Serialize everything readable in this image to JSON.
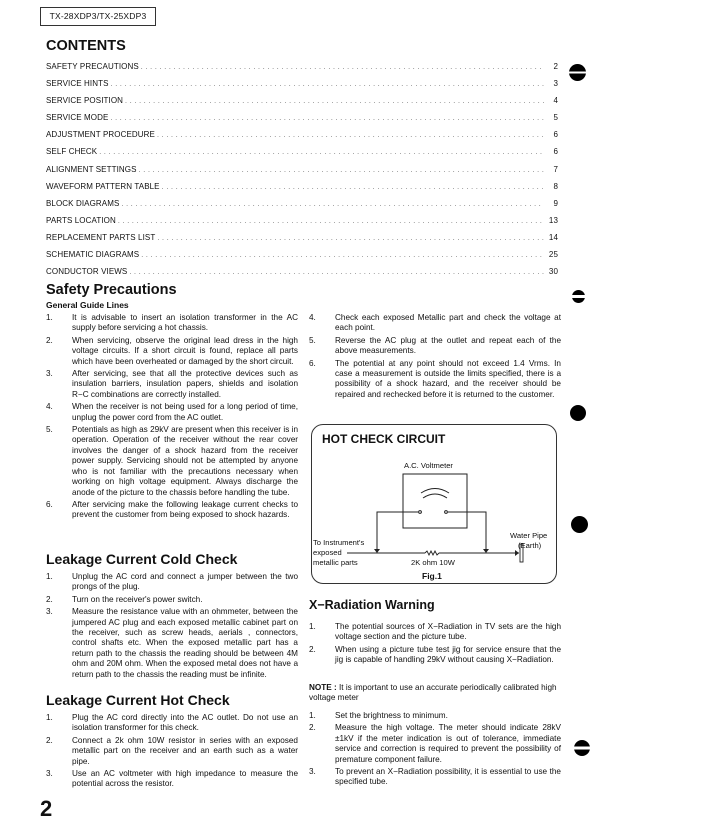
{
  "header": {
    "model": "TX-28XDP3/TX-25XDP3"
  },
  "contents": {
    "title": "CONTENTS",
    "items": [
      {
        "label": "SAFETY PRECAUTIONS",
        "page": "2"
      },
      {
        "label": "SERVICE HINTS",
        "page": "3"
      },
      {
        "label": "SERVICE POSITION",
        "page": "4"
      },
      {
        "label": "SERVICE MODE",
        "page": "5"
      },
      {
        "label": "ADJUSTMENT PROCEDURE",
        "page": "6"
      },
      {
        "label": "SELF CHECK",
        "page": "6"
      },
      {
        "label": "ALIGNMENT SETTINGS",
        "page": "7"
      },
      {
        "label": "WAVEFORM PATTERN TABLE",
        "page": "8"
      },
      {
        "label": "BLOCK DIAGRAMS",
        "page": "9"
      },
      {
        "label": "PARTS LOCATION",
        "page": "13"
      },
      {
        "label": "REPLACEMENT PARTS LIST",
        "page": "14"
      },
      {
        "label": "SCHEMATIC DIAGRAMS",
        "page": "25"
      },
      {
        "label": "CONDUCTOR VIEWS",
        "page": "30"
      }
    ]
  },
  "safety": {
    "title": "Safety Precautions",
    "subtitle": "General Guide Lines",
    "items": [
      {
        "num": "1.",
        "text": "It is advisable to insert an isolation transformer in the AC supply before servicing a hot chassis."
      },
      {
        "num": "2.",
        "text": "When servicing, observe the original lead dress in the high voltage circuits. If a short circuit is found, replace all parts which have been overheated or damaged by the short circuit."
      },
      {
        "num": "3.",
        "text": "After servicing, see that all the protective devices such as insulation barriers, insulation papers, shields and isolation R−C combinations are correctly installed."
      },
      {
        "num": "4.",
        "text": "When the receiver is not being used for a long period of time, unplug the power cord from the AC outlet."
      },
      {
        "num": "5.",
        "text": "Potentials as high as 29kV are present when this receiver is in operation. Operation of the receiver without the rear cover involves the danger of a shock hazard from the receiver power supply. Servicing should not be attempted by anyone who is not familiar with the precautions necessary when working on high voltage equipment. Always discharge the anode of the picture to the chassis before handling the tube."
      },
      {
        "num": "6.",
        "text": "After servicing make the following leakage current checks to prevent the customer from being exposed to shock hazards."
      }
    ]
  },
  "cold_check": {
    "title": "Leakage Current Cold Check",
    "items": [
      {
        "num": "1.",
        "text": "Unplug the AC cord and connect a jumper between the two prongs of the plug."
      },
      {
        "num": "2.",
        "text": "Turn on the receiver's power switch."
      },
      {
        "num": "3.",
        "text": "Measure the resistance value with an ohmmeter, between the jumpered AC plug and each exposed metallic cabinet part on the receiver, such as screw heads, aerials , connectors, control shafts etc. When the exposed metallic part has a return path to the chassis the reading should be between 4M ohm and 20M ohm. When the exposed metal does not have a return path to the chassis the reading must be infinite."
      }
    ]
  },
  "hot_check": {
    "title": "Leakage Current Hot Check",
    "items": [
      {
        "num": "1.",
        "text": "Plug the AC cord directly into the AC outlet. Do not use an isolation transformer for this check."
      },
      {
        "num": "2.",
        "text": "Connect a 2k ohm 10W resistor in series with an exposed metallic part on the receiver and an earth such as a water pipe."
      },
      {
        "num": "3.",
        "text": "Use an AC voltmeter with high impedance to measure the potential across the resistor."
      }
    ],
    "continued": [
      {
        "num": "4.",
        "text": "Check each exposed Metallic part and check the voltage at each point."
      },
      {
        "num": "5.",
        "text": "Reverse the AC plug at the outlet and repeat each of the above measurements."
      },
      {
        "num": "6.",
        "text": "The potential at any point should not exceed 1.4 Vrms. In case a measurement is outside the limits specified, there is a possibility of a shock hazard, and the receiver should be repaired and rechecked before it is returned to the customer."
      }
    ]
  },
  "circuit": {
    "title": "HOT CHECK CIRCUIT",
    "voltmeter": "A.C. Voltmeter",
    "instrument_line1": "To Instrument's",
    "instrument_line2": "exposed",
    "instrument_line3": "metallic parts",
    "resistor": "2K ohm 10W",
    "pipe_line1": "Water Pipe",
    "pipe_line2": "(Earth)",
    "caption": "Fig.1"
  },
  "xray": {
    "title": "X−Radiation Warning",
    "items": [
      {
        "num": "1.",
        "text": "The potential sources of X−Radiation in TV sets are the high voltage section and the picture tube."
      },
      {
        "num": "2.",
        "text": "When using a picture tube test jig for service ensure that the jig is capable of handling 29kV without causing X−Radiation."
      }
    ],
    "note_label": "NOTE :",
    "note_text": " It is important to use an accurate periodically calibrated high voltage meter",
    "steps": [
      {
        "num": "1.",
        "text": "Set the brightness to minimum."
      },
      {
        "num": "2.",
        "text": "Measure the high voltage. The meter should indicate 28kV ±1kV if the meter indication is out of tolerance, immediate service and correction is required to prevent the possibility of premature component failure."
      },
      {
        "num": "3.",
        "text": "To prevent an X−Radiation possibility, it is essential to use the specified tube."
      }
    ]
  },
  "footer": {
    "page_number": "2"
  }
}
